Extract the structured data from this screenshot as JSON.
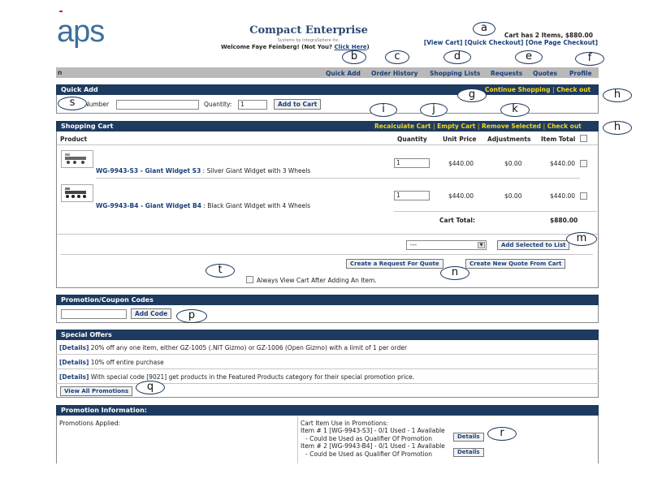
{
  "header": {
    "logo_text": "aps",
    "company_name": "Compact Enterprise",
    "company_sub": "Systems by IntegraSphere Inc.",
    "welcome_text": "Welcome Faye Feinberg! (Not You? ",
    "welcome_link": "Click Here",
    "welcome_end": ")",
    "cart_summary": "Cart has 2 Items, $880.00",
    "cart_links": [
      "[View Cart]",
      "[Quick Checkout]",
      "[One Page Checkout]"
    ]
  },
  "nav": {
    "left_fragment": "n",
    "items": [
      "Quick Add",
      "Order History",
      "Shopping Lists",
      "Requests",
      "Quotes",
      "Profile"
    ]
  },
  "quick_add": {
    "title": "Quick Add",
    "continue_shopping": "Continue Shopping",
    "checkout": "Check out",
    "number_label": "Number",
    "quantity_label": "Quantity:",
    "quantity_value": "1",
    "add_button": "Add to Cart"
  },
  "cart": {
    "title": "Shopping Cart",
    "actions": [
      "Recalculate Cart",
      "Empty Cart",
      "Remove Selected",
      "Check out"
    ],
    "columns": [
      "Product",
      "Quantity",
      "Unit Price",
      "Adjustments",
      "Item Total"
    ],
    "items": [
      {
        "sku_name": "WG-9943-S3 - Giant Widget S3",
        "desc": " : Silver Giant Widget with 3 Wheels",
        "qty": "1",
        "unit_price": "$440.00",
        "adjustments": "$0.00",
        "total": "$440.00"
      },
      {
        "sku_name": "WG-9943-B4 - Giant Widget B4",
        "desc": " : Black Giant Widget with 4 Wheels",
        "qty": "1",
        "unit_price": "$440.00",
        "adjustments": "$0.00",
        "total": "$440.00"
      }
    ],
    "total_label": "Cart Total:",
    "total_value": "$880.00",
    "list_select_value": "---",
    "add_selected_button": "Add Selected to List",
    "request_quote_button": "Create a Request For Quote",
    "new_quote_button": "Create New Quote From Cart",
    "always_view_label": "Always View Cart After Adding An Item."
  },
  "promo_codes": {
    "title": "Promotion/Coupon Codes",
    "add_button": "Add Code"
  },
  "special_offers": {
    "title": "Special Offers",
    "details_label": "[Details]",
    "offers": [
      " 20% off any one item, either GZ-1005 (.NIT Gizmo) or GZ-1006 (Open Gizmo) with a limit of 1 per order",
      " 10% off entire purchase",
      " With special code [9021] get products in the Featured Products category for their special promotion price."
    ],
    "view_all_button": "View All Promotions"
  },
  "promo_info": {
    "title": "Promotion Information:",
    "applied_label": "Promotions Applied:",
    "usage_heading": "Cart Item Use in Promotions:",
    "lines": [
      "Item # 1 [WG-9943-S3] - 0/1 Used - 1 Available",
      "- Could be Used as Qualifier Of Promotion",
      "Item # 2 [WG-9943-B4] - 0/1 Used - 1 Available",
      "- Could be Used as Qualifier Of Promotion"
    ],
    "details_button": "Details"
  },
  "callouts": [
    "a",
    "b",
    "c",
    "d",
    "e",
    "f",
    "g",
    "h",
    "h",
    "i",
    "j",
    "k",
    "m",
    "n",
    "p",
    "q",
    "r",
    "s",
    "t"
  ],
  "colors": {
    "section_bar": "#1e3a5f",
    "bar_link": "#f1d71b",
    "nav_bg": "#b9b9b9",
    "link": "#1b3f7a",
    "logo": "#3e6f9c"
  }
}
